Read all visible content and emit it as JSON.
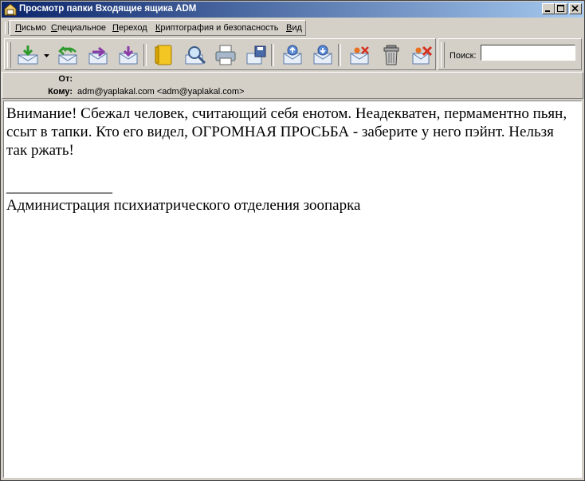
{
  "window": {
    "title": "Просмотр папки Входящие ящика ADM"
  },
  "menu": [
    "Письмо",
    "Специальное",
    "Переход",
    "Криптография и безопасность",
    "Вид"
  ],
  "toolbar": {
    "search_label": "Поиск:",
    "search_value": ""
  },
  "headers": {
    "from_label": "От:",
    "from_value": "",
    "to_label": "Кому:",
    "to_value": "adm@yaplakal.com <adm@yaplakal.com>"
  },
  "message": {
    "paragraph": "Внимание! Сбежал человек, считающий себя енотом. Неадекватен, пермаментно пьян, ссыт в тапки. Кто его видел, ОГРОМНАЯ ПРОСЬБА - заберите у него пэйнт. Нельзя так ржать!",
    "signature_separator": "______________",
    "signature": "Администрация психиатрического отделения зоопарка"
  }
}
